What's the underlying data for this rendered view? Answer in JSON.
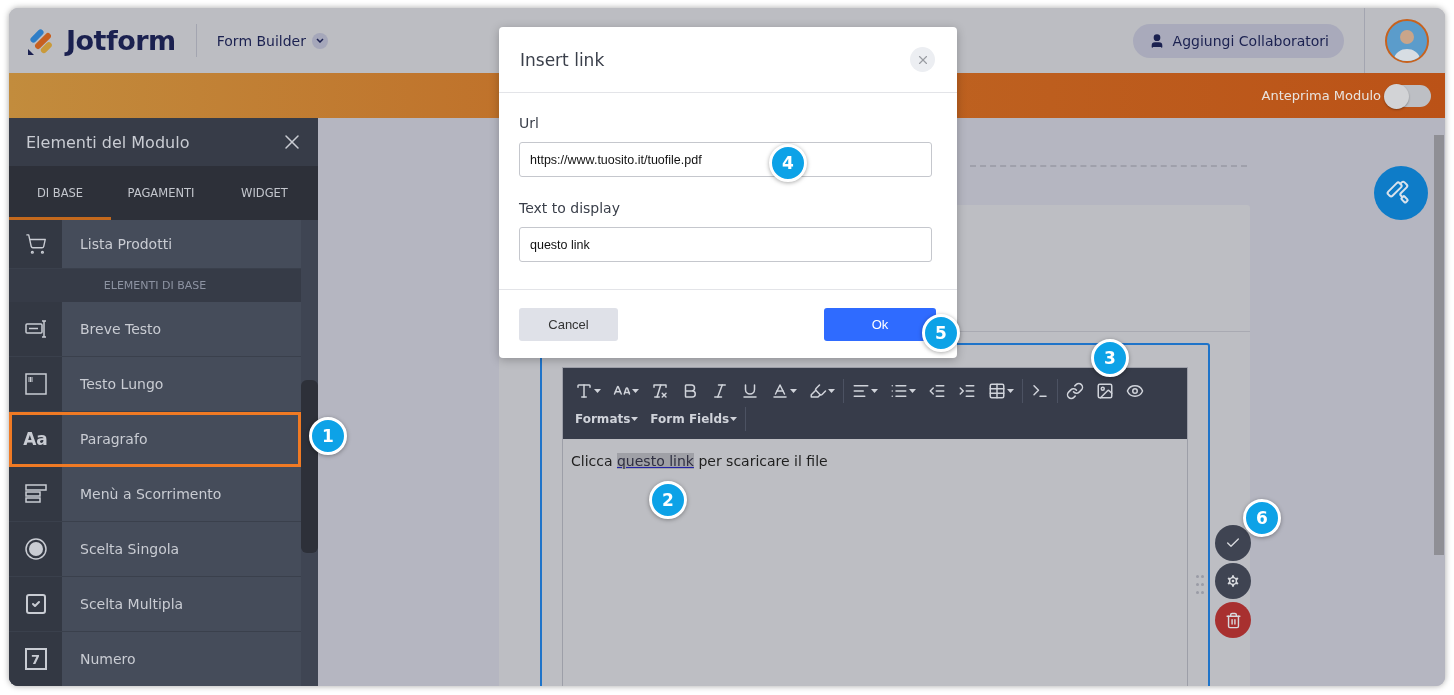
{
  "header": {
    "brand": "Jotform",
    "menu": "Form Builder",
    "collaborators_button": "Aggiungi Collaboratori"
  },
  "preview_bar": {
    "label": "Anteprima Modulo",
    "on": false
  },
  "sidebar": {
    "title": "Elementi del Modulo",
    "tabs": [
      {
        "label": "DI BASE",
        "selected": true
      },
      {
        "label": "PAGAMENTI",
        "selected": false
      },
      {
        "label": "WIDGET",
        "selected": false
      }
    ],
    "items_above": [
      {
        "label": "Lista Prodotti",
        "selected": false
      }
    ],
    "section": "ELEMENTI DI BASE",
    "items": [
      {
        "label": "Breve Testo",
        "selected": false
      },
      {
        "label": "Testo Lungo",
        "selected": false
      },
      {
        "label": "Paragrafo",
        "selected": true,
        "icon_glyph": "Aa"
      },
      {
        "label": "Menù a Scorrimento",
        "selected": false
      },
      {
        "label": "Scelta Singola",
        "selected": false
      },
      {
        "label": "Scelta Multipla",
        "selected": false
      },
      {
        "label": "Numero",
        "selected": false,
        "icon_glyph": "7"
      }
    ]
  },
  "editor": {
    "menus": [
      "Formats",
      "Form Fields"
    ],
    "text": {
      "before": "Clicca",
      "link": "questo link",
      "after": "per scaricare il file"
    }
  },
  "dialog": {
    "title": "Insert link",
    "fields": [
      {
        "label": "Url",
        "value": "https://www.tuosito.it/tuofile.pdf"
      },
      {
        "label": "Text to display",
        "value": "questo link"
      }
    ],
    "buttons": [
      {
        "kind": "secondary",
        "label": "Cancel"
      },
      {
        "kind": "primary",
        "label": "Ok"
      }
    ]
  },
  "callouts": [
    "1",
    "2",
    "3",
    "4",
    "5",
    "6"
  ]
}
